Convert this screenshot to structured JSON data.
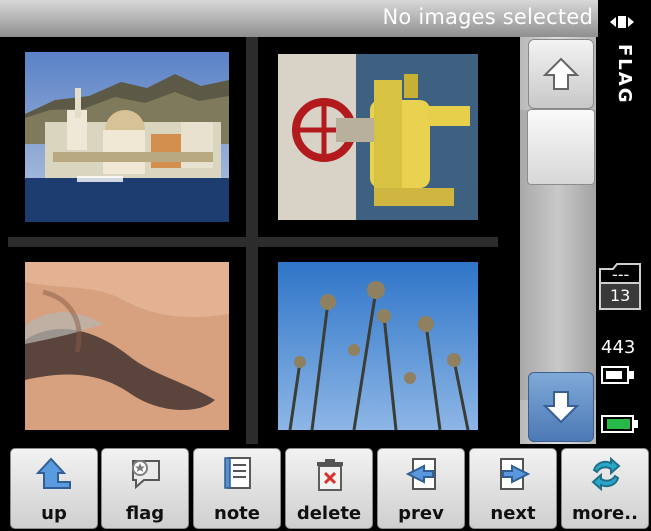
{
  "status": {
    "text": "No images selected"
  },
  "side_panel": {
    "mode_label": "FLAG",
    "folder_count": "13",
    "folder_icon_label": "---",
    "battery_count": "443"
  },
  "toolbar": {
    "buttons": [
      {
        "label": "up",
        "icon": "up-arrow-icon"
      },
      {
        "label": "flag",
        "icon": "flag-bubble-icon"
      },
      {
        "label": "note",
        "icon": "note-icon"
      },
      {
        "label": "delete",
        "icon": "trash-icon"
      },
      {
        "label": "prev",
        "icon": "prev-icon"
      },
      {
        "label": "next",
        "icon": "next-icon"
      },
      {
        "label": "more..",
        "icon": "refresh-icon"
      }
    ]
  },
  "colors": {
    "accent_blue": "#4c79b6",
    "status_bg": "#bcbcbc",
    "battery_green": "#27b84a"
  }
}
